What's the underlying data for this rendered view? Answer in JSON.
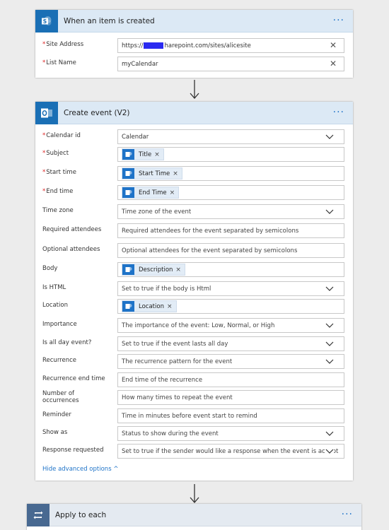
{
  "trigger": {
    "title": "When an item is created",
    "menu": "···",
    "site_label": "Site Address",
    "site_prefix": "https://",
    "site_suffix": "harepoint.com/sites/alicesite",
    "list_label": "List Name",
    "list_value": "myCalendar",
    "clear": "✕"
  },
  "action": {
    "title": "Create event (V2)",
    "menu": "···",
    "fields": {
      "calendar_id": {
        "label": "Calendar id",
        "value": "Calendar"
      },
      "subject": {
        "label": "Subject",
        "token": "Title"
      },
      "start_time": {
        "label": "Start time",
        "token": "Start Time"
      },
      "end_time": {
        "label": "End time",
        "token": "End Time"
      },
      "time_zone": {
        "label": "Time zone",
        "placeholder": "Time zone of the event"
      },
      "required_attendees": {
        "label": "Required attendees",
        "placeholder": "Required attendees for the event separated by semicolons"
      },
      "optional_attendees": {
        "label": "Optional attendees",
        "placeholder": "Optional attendees for the event separated by semicolons"
      },
      "body": {
        "label": "Body",
        "token": "Description"
      },
      "is_html": {
        "label": "Is HTML",
        "placeholder": "Set to true if the body is Html"
      },
      "location": {
        "label": "Location",
        "token": "Location"
      },
      "importance": {
        "label": "Importance",
        "placeholder": "The importance of the event: Low, Normal, or High"
      },
      "is_all_day": {
        "label": "Is all day event?",
        "placeholder": "Set to true if the event lasts all day"
      },
      "recurrence": {
        "label": "Recurrence",
        "placeholder": "The recurrence pattern for the event"
      },
      "recurrence_end": {
        "label": "Recurrence end time",
        "placeholder": "End time of the recurrence"
      },
      "occurrences": {
        "label_line1": "Number of",
        "label_line2": "occurrences",
        "placeholder": "How many times to repeat the event"
      },
      "reminder": {
        "label": "Reminder",
        "placeholder": "Time in minutes before event start to remind"
      },
      "show_as": {
        "label": "Show as",
        "placeholder": "Status to show during the event"
      },
      "response_requested": {
        "label": "Response requested",
        "placeholder": "Set to true if the sender would like a response when the event is accept"
      }
    },
    "token_remove": "×",
    "hide_advanced": "Hide advanced options ^"
  },
  "apply_each": {
    "title": "Apply to each",
    "menu": "···"
  },
  "colors": {
    "accent": "#1e73c8",
    "header_bg": "#dce9f5",
    "canvas_bg": "#ececec",
    "loop_icon_bg": "#486991",
    "outlook_blue": "#0f6cbd",
    "sharepoint_blue": "#036c70"
  }
}
